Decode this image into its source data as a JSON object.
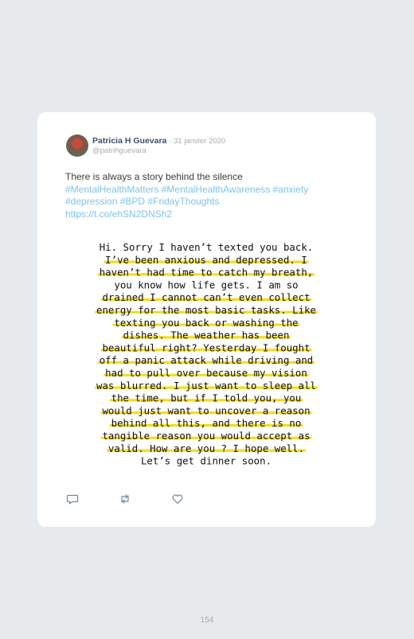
{
  "tweet": {
    "author_name": "Patricia H Guevara",
    "date": "· 31 janvier 2020",
    "handle": "@patrihguevara",
    "text": "There is always a story behind the silence",
    "hashtags": [
      "#MentalHealthMatters",
      "#MentalHealthAwareness",
      "#anxiety",
      "#depression",
      "#BPD",
      "#FridayThoughts"
    ],
    "link": "https://t.co/ehSN2DNSh2",
    "image_lines": [
      "Hi. Sorry I haven’t texted you back.",
      "I’ve been anxious and depressed. I",
      "haven’t had time to catch my breath,",
      "you know how life gets. I am so",
      "drained I cannot can’t even collect",
      "energy for the most basic tasks. Like",
      "texting you back or washing the",
      "dishes. The weather has been",
      "beautiful right? Yesterday I fought",
      "off a panic attack while driving and",
      "had to pull over because my vision",
      "was blurred. I just want to sleep all",
      "the time, but if I told you, you",
      "would just want to uncover a reason",
      "behind all this, and there is no",
      "tangible reason you would accept as",
      "valid. How are you ? I hope well.",
      "Let’s get dinner soon."
    ],
    "highlight_color": "#f5d800"
  },
  "actions": {
    "reply_icon": "reply-icon",
    "retweet_icon": "retweet-icon",
    "like_icon": "heart-icon"
  },
  "page_number": "154"
}
